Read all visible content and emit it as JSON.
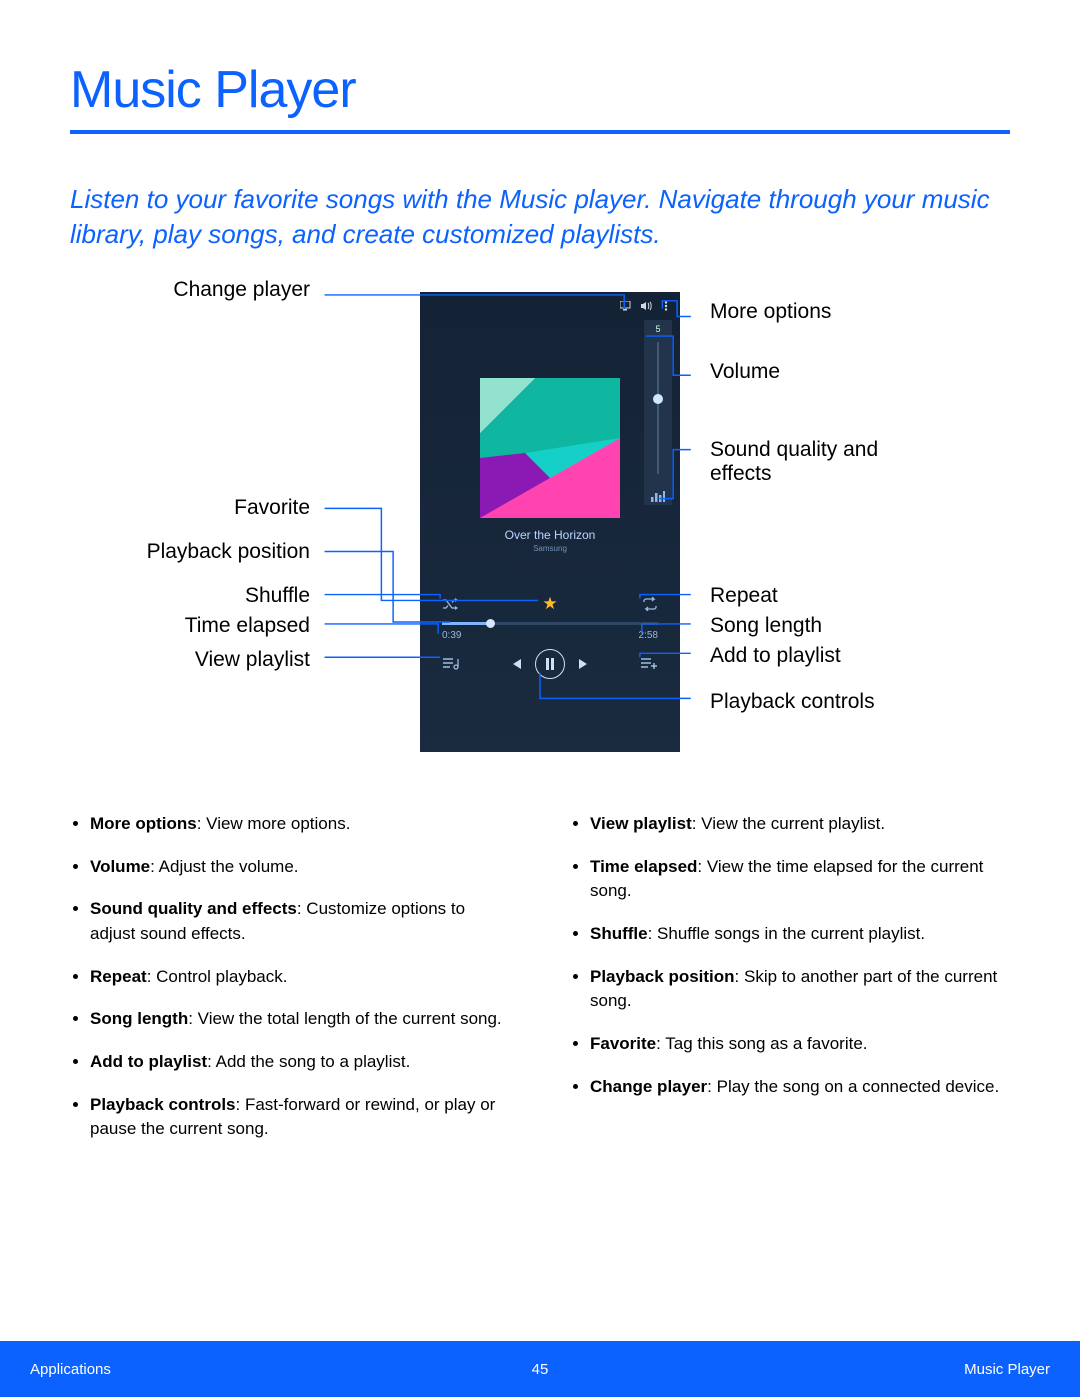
{
  "title": "Music Player",
  "intro": "Listen to your favorite songs with the Music player. Navigate through your music library, play songs, and create customized playlists.",
  "phone": {
    "song_title": "Over the Horizon",
    "artist": "Samsung",
    "time_elapsed": "0:39",
    "song_length": "2:58",
    "volume_level": "5"
  },
  "callouts_left": {
    "change_player": "Change player",
    "favorite": "Favorite",
    "playback_position": "Playback position",
    "shuffle": "Shuffle",
    "time_elapsed": "Time elapsed",
    "view_playlist": "View playlist"
  },
  "callouts_right": {
    "more_options": "More options",
    "volume": "Volume",
    "sound_quality": "Sound quality and effects",
    "repeat": "Repeat",
    "song_length": "Song length",
    "add_to_playlist": "Add to playlist",
    "playback_controls": "Playback controls"
  },
  "bullets_left": [
    {
      "term": "More options",
      "desc": ": View more options."
    },
    {
      "term": "Volume",
      "desc": ": Adjust the volume."
    },
    {
      "term": "Sound quality and effects",
      "desc": ": Customize options to adjust sound effects."
    },
    {
      "term": "Repeat",
      "desc": ": Control playback."
    },
    {
      "term": "Song length",
      "desc": ": View the total length of the current song."
    },
    {
      "term": "Add to playlist",
      "desc": ": Add the song to a playlist."
    },
    {
      "term": "Playback controls",
      "desc": ": Fast-forward or rewind, or play or pause the current song."
    }
  ],
  "bullets_right": [
    {
      "term": "View playlist",
      "desc": ": View the current playlist."
    },
    {
      "term": "Time elapsed",
      "desc": ": View the time elapsed for the current song."
    },
    {
      "term": "Shuffle",
      "desc": ": Shuffle songs in the current playlist."
    },
    {
      "term": "Playback position",
      "desc": ": Skip to another part of the current song."
    },
    {
      "term": "Favorite",
      "desc": ": Tag this song as a favorite."
    },
    {
      "term": "Change player",
      "desc": ": Play the song on a connected device."
    }
  ],
  "footer": {
    "left": "Applications",
    "page": "45",
    "right": "Music Player"
  }
}
